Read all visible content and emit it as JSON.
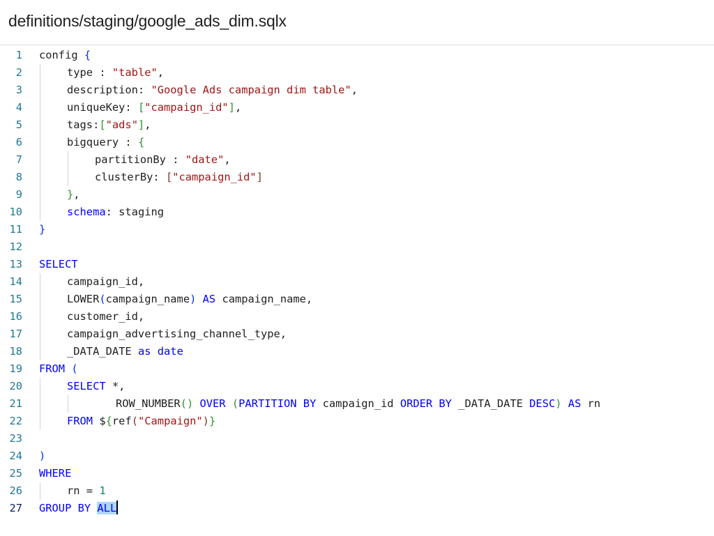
{
  "file": {
    "path": "definitions/staging/google_ads_dim.sqlx"
  },
  "editor": {
    "active_line": 27,
    "lines": [
      {
        "n": "1",
        "indent": 0,
        "tokens": [
          [
            "def",
            "config "
          ],
          [
            "b1",
            "{"
          ]
        ]
      },
      {
        "n": "2",
        "indent": 1,
        "tokens": [
          [
            "def",
            "type : "
          ],
          [
            "str",
            "\"table\""
          ],
          [
            "def",
            ","
          ]
        ]
      },
      {
        "n": "3",
        "indent": 1,
        "tokens": [
          [
            "def",
            "description: "
          ],
          [
            "str",
            "\"Google Ads campaign dim table\""
          ],
          [
            "def",
            ","
          ]
        ]
      },
      {
        "n": "4",
        "indent": 1,
        "tokens": [
          [
            "def",
            "uniqueKey: "
          ],
          [
            "b2",
            "["
          ],
          [
            "str",
            "\"campaign_id\""
          ],
          [
            "b2",
            "]"
          ],
          [
            "def",
            ","
          ]
        ]
      },
      {
        "n": "5",
        "indent": 1,
        "tokens": [
          [
            "def",
            "tags:"
          ],
          [
            "b2",
            "["
          ],
          [
            "str",
            "\"ads\""
          ],
          [
            "b2",
            "]"
          ],
          [
            "def",
            ","
          ]
        ]
      },
      {
        "n": "6",
        "indent": 1,
        "tokens": [
          [
            "def",
            "bigquery : "
          ],
          [
            "b2",
            "{"
          ]
        ]
      },
      {
        "n": "7",
        "indent": 2,
        "tokens": [
          [
            "def",
            "partitionBy : "
          ],
          [
            "str",
            "\"date\""
          ],
          [
            "def",
            ","
          ]
        ]
      },
      {
        "n": "8",
        "indent": 2,
        "tokens": [
          [
            "def",
            "clusterBy: "
          ],
          [
            "b3",
            "["
          ],
          [
            "str",
            "\"campaign_id\""
          ],
          [
            "b3",
            "]"
          ]
        ]
      },
      {
        "n": "9",
        "indent": 1,
        "tokens": [
          [
            "b2",
            "}"
          ],
          [
            "def",
            ","
          ]
        ]
      },
      {
        "n": "10",
        "indent": 1,
        "tokens": [
          [
            "kw",
            "schema"
          ],
          [
            "def",
            ": staging"
          ]
        ]
      },
      {
        "n": "11",
        "indent": 0,
        "tokens": [
          [
            "b1",
            "}"
          ]
        ]
      },
      {
        "n": "12",
        "indent": 0,
        "tokens": []
      },
      {
        "n": "13",
        "indent": 0,
        "tokens": [
          [
            "kw",
            "SELECT"
          ]
        ]
      },
      {
        "n": "14",
        "indent": 1,
        "tokens": [
          [
            "def",
            "campaign_id,"
          ]
        ]
      },
      {
        "n": "15",
        "indent": 1,
        "tokens": [
          [
            "def",
            "LOWER"
          ],
          [
            "b1",
            "("
          ],
          [
            "def",
            "campaign_name"
          ],
          [
            "b1",
            ")"
          ],
          [
            "def",
            " "
          ],
          [
            "kw",
            "AS"
          ],
          [
            "def",
            " campaign_name,"
          ]
        ]
      },
      {
        "n": "16",
        "indent": 1,
        "tokens": [
          [
            "def",
            "customer_id,"
          ]
        ]
      },
      {
        "n": "17",
        "indent": 1,
        "tokens": [
          [
            "def",
            "campaign_advertising_channel_type,"
          ]
        ]
      },
      {
        "n": "18",
        "indent": 1,
        "tokens": [
          [
            "def",
            "_DATA_DATE "
          ],
          [
            "kw",
            "as"
          ],
          [
            "def",
            " "
          ],
          [
            "kw",
            "date"
          ]
        ]
      },
      {
        "n": "19",
        "indent": 0,
        "tokens": [
          [
            "kw",
            "FROM"
          ],
          [
            "def",
            " "
          ],
          [
            "b1",
            "("
          ]
        ]
      },
      {
        "n": "20",
        "indent": 1,
        "tokens": [
          [
            "kw",
            "SELECT"
          ],
          [
            "def",
            " *,"
          ]
        ]
      },
      {
        "n": "21",
        "indent": 3,
        "tokens": [
          [
            "def",
            "ROW_NUMBER"
          ],
          [
            "b2",
            "()"
          ],
          [
            "def",
            " "
          ],
          [
            "kw",
            "OVER"
          ],
          [
            "def",
            " "
          ],
          [
            "b2",
            "("
          ],
          [
            "kw",
            "PARTITION BY"
          ],
          [
            "def",
            " campaign_id "
          ],
          [
            "kw",
            "ORDER BY"
          ],
          [
            "def",
            " _DATA_DATE "
          ],
          [
            "kw",
            "DESC"
          ],
          [
            "b2",
            ")"
          ],
          [
            "def",
            " "
          ],
          [
            "kw",
            "AS"
          ],
          [
            "def",
            " rn"
          ]
        ]
      },
      {
        "n": "22",
        "indent": 1,
        "tokens": [
          [
            "kw",
            "FROM"
          ],
          [
            "def",
            " $"
          ],
          [
            "b2",
            "{"
          ],
          [
            "def",
            "ref"
          ],
          [
            "b3",
            "("
          ],
          [
            "str",
            "\"Campaign\""
          ],
          [
            "b3",
            ")"
          ],
          [
            "b2",
            "}"
          ]
        ]
      },
      {
        "n": "23",
        "indent": 0,
        "tokens": []
      },
      {
        "n": "24",
        "indent": 0,
        "tokens": [
          [
            "b1",
            ")"
          ]
        ]
      },
      {
        "n": "25",
        "indent": 0,
        "tokens": [
          [
            "kw",
            "WHERE"
          ]
        ]
      },
      {
        "n": "26",
        "indent": 1,
        "tokens": [
          [
            "def",
            "rn = "
          ],
          [
            "num",
            "1"
          ]
        ]
      },
      {
        "n": "27",
        "indent": 0,
        "tokens": [
          [
            "kw",
            "GROUP BY "
          ],
          [
            "sel",
            "ALL"
          ]
        ]
      }
    ]
  },
  "colors": {
    "keyword": "#0000ff",
    "string": "#a31515",
    "number": "#098658",
    "line_number": "#237893",
    "selection": "#add6ff"
  }
}
